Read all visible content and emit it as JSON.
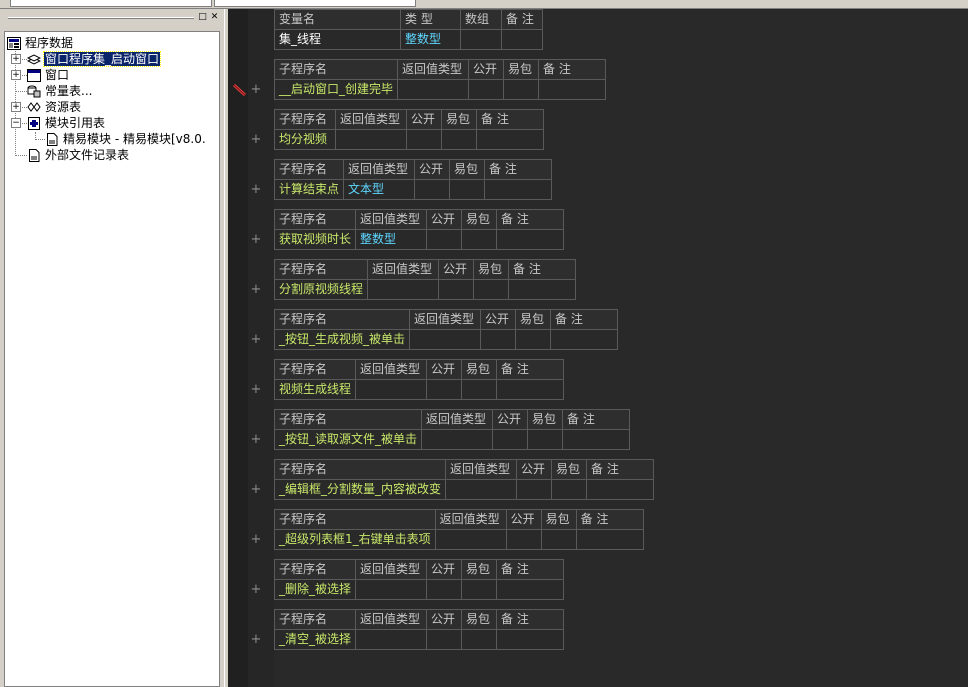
{
  "left_panel": {
    "tree": [
      {
        "label": "程序数据",
        "icon": "program-data-icon"
      },
      {
        "label": "窗口程序集_启动窗口",
        "icon": "assembly-icon"
      },
      {
        "label": "窗口",
        "icon": "window-icon"
      },
      {
        "label": "常量表...",
        "icon": "constant-table-icon"
      },
      {
        "label": "资源表",
        "icon": "resource-table-icon"
      },
      {
        "label": "模块引用表",
        "icon": "module-ref-icon"
      },
      {
        "label": "精易模块 - 精易模块[v8.0.",
        "icon": "module-item-icon"
      },
      {
        "label": "外部文件记录表",
        "icon": "external-file-icon"
      }
    ],
    "pin_label": "□",
    "close_label": "✕"
  },
  "editor": {
    "var_table": {
      "headers": [
        "变量名",
        "类 型",
        "数组",
        "备 注"
      ],
      "row": [
        "集_线程",
        "整数型",
        "",
        ""
      ]
    },
    "sub_headers": [
      "子程序名",
      "返回值类型",
      "公开",
      "易包",
      "备 注"
    ],
    "subs": [
      {
        "name": "__启动窗口_创建完毕",
        "ret": ""
      },
      {
        "name": "均分视频",
        "ret": ""
      },
      {
        "name": "计算结束点",
        "ret": "文本型"
      },
      {
        "name": "获取视频时长",
        "ret": "整数型"
      },
      {
        "name": "分割原视频线程",
        "ret": ""
      },
      {
        "name": "_按钮_生成视频_被单击",
        "ret": ""
      },
      {
        "name": "视频生成线程",
        "ret": ""
      },
      {
        "name": "_按钮_读取源文件_被单击",
        "ret": ""
      },
      {
        "name": "_编辑框_分割数量_内容被改变",
        "ret": ""
      },
      {
        "name": "_超级列表框1_右键单击表项",
        "ret": ""
      },
      {
        "name": "_删除_被选择",
        "ret": ""
      },
      {
        "name": "_清空_被选择",
        "ret": ""
      }
    ],
    "plus_symbol": "+"
  },
  "colors": {
    "editor_bg": "#292929",
    "name_color": "#c8e86a",
    "type_color": "#5fd7ff",
    "selection": "#0a246a"
  }
}
